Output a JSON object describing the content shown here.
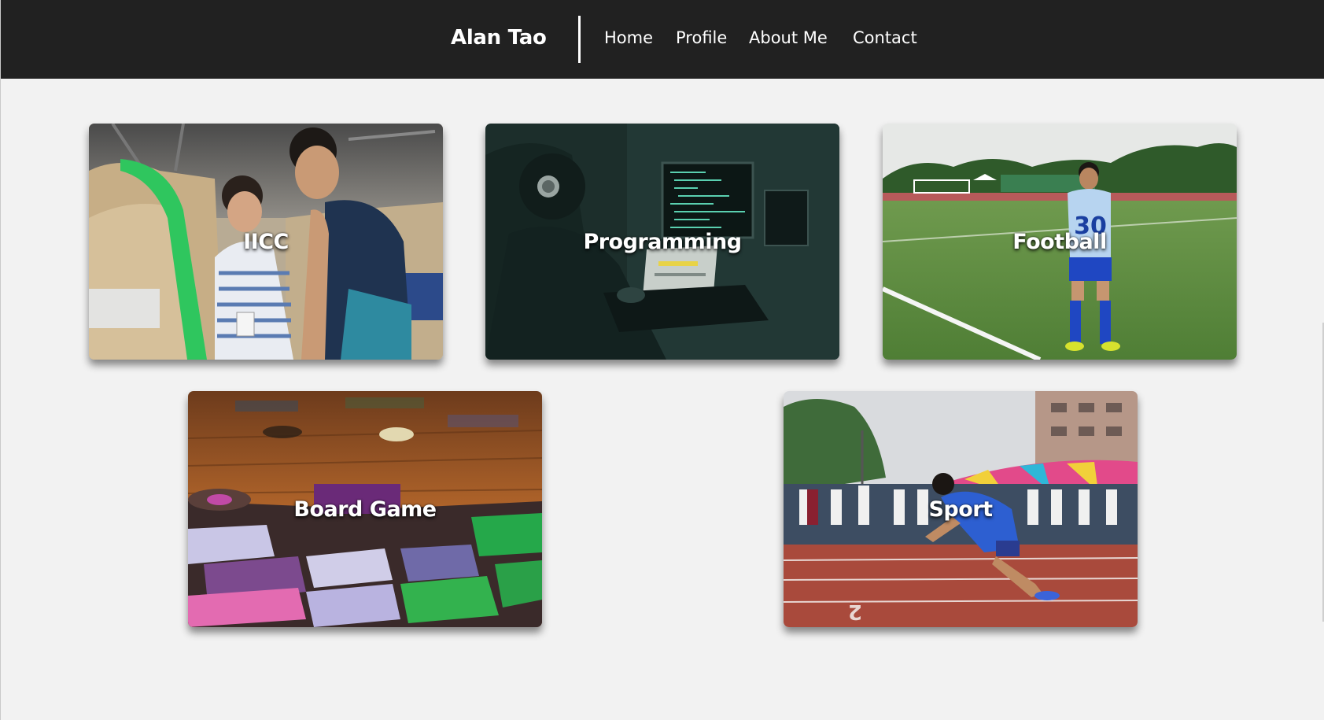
{
  "nav": {
    "brand": "Alan Tao",
    "links": [
      {
        "label": "Home"
      },
      {
        "label": "Profile"
      },
      {
        "label": "About Me"
      },
      {
        "label": "Contact"
      }
    ]
  },
  "cards": [
    {
      "label": "IICC"
    },
    {
      "label": "Programming"
    },
    {
      "label": "Football"
    },
    {
      "label": "Board Game"
    },
    {
      "label": "Sport"
    }
  ],
  "colors": {
    "navbar_bg": "#212121",
    "page_bg": "#f2f2f2",
    "text_light": "#ffffff"
  }
}
